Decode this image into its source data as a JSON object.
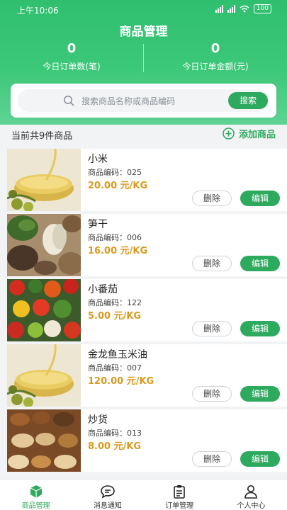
{
  "status": {
    "time": "上午10:06",
    "battery": "100"
  },
  "header": {
    "title": "商品管理"
  },
  "stats": [
    {
      "value": "0",
      "label": "今日订单数(笔)"
    },
    {
      "value": "0",
      "label": "今日订单金额(元)"
    }
  ],
  "search": {
    "placeholder": "搜索商品名称或商品编码",
    "button": "搜索"
  },
  "list": {
    "count_text": "当前共9件商品",
    "add_label": "添加商品"
  },
  "products": [
    {
      "name": "小米",
      "code": "商品编码：025",
      "price": "20.00 元/KG",
      "delete": "删除",
      "edit": "编辑",
      "image": "olive-oil"
    },
    {
      "name": "笋干",
      "code": "商品编码：006",
      "price": "16.00 元/KG",
      "delete": "删除",
      "edit": "编辑",
      "image": "dried-vegetables"
    },
    {
      "name": "小番茄",
      "code": "商品编码：122",
      "price": "5.00 元/KG",
      "delete": "删除",
      "edit": "编辑",
      "image": "vegetables"
    },
    {
      "name": "金龙鱼玉米油",
      "code": "商品编码：007",
      "price": "120.00 元/KG",
      "delete": "删除",
      "edit": "编辑",
      "image": "olive-oil"
    },
    {
      "name": "炒货",
      "code": "商品编码：013",
      "price": "8.00 元/KG",
      "delete": "删除",
      "edit": "编辑",
      "image": "nuts"
    }
  ],
  "tabs": [
    {
      "label": "商品管理",
      "icon": "box-icon",
      "active": true
    },
    {
      "label": "消息通知",
      "icon": "chat-icon",
      "active": false
    },
    {
      "label": "订单管理",
      "icon": "clipboard-icon",
      "active": false
    },
    {
      "label": "个人中心",
      "icon": "person-icon",
      "active": false
    }
  ],
  "colors": {
    "primary": "#2daa5e",
    "price": "#d99a1e"
  }
}
